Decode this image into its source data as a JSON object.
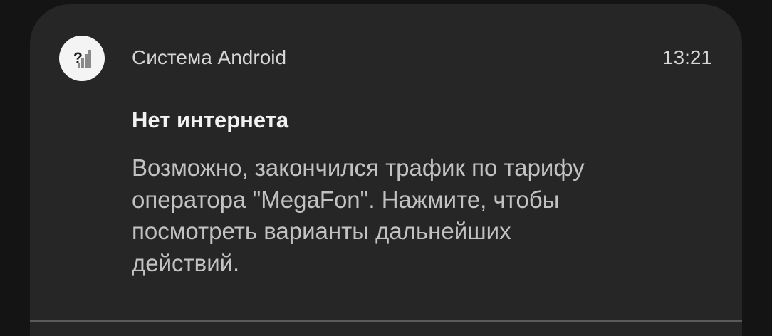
{
  "notification": {
    "app_name": "Система Android",
    "time": "13:21",
    "icon": "no-signal-question-icon",
    "title": "Нет интернета",
    "body_lines": [
      "Возможно, закончился трафик по тарифу",
      "оператора \"MegaFon\". Нажмите, чтобы",
      "посмотреть варианты дальнейших",
      "действий."
    ]
  },
  "colors": {
    "background": "#141414",
    "card": "#262626",
    "title_text": "#f2f2f2",
    "body_text": "#c2c2c2",
    "icon_bg": "#f4f4f4"
  }
}
